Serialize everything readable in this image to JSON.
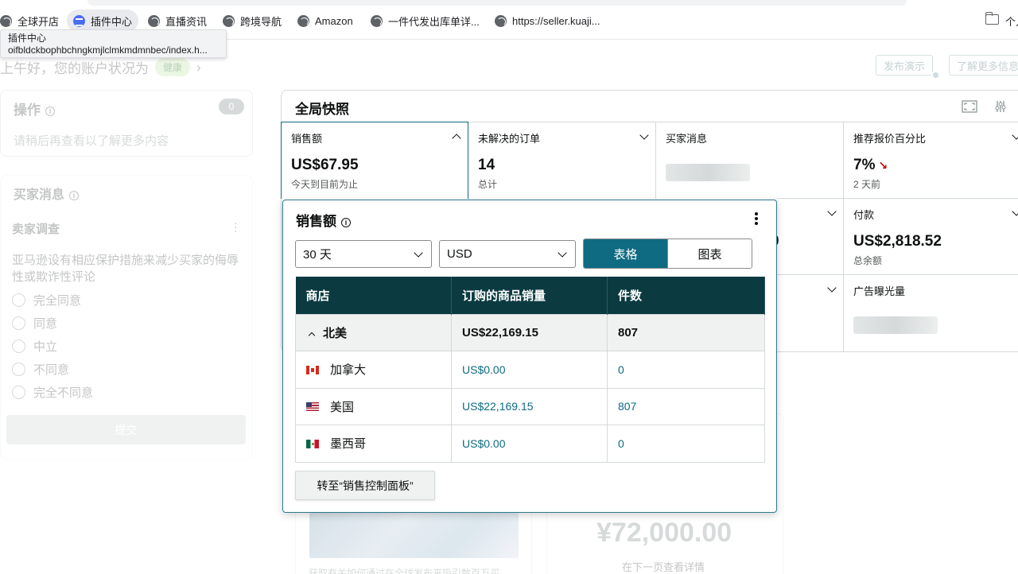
{
  "bookmarks": [
    {
      "label": "全球开店",
      "icon": "globe-icon"
    },
    {
      "label": "插件中心",
      "icon": "extension-icon"
    },
    {
      "label": "直播资讯",
      "icon": "globe-icon"
    },
    {
      "label": "跨境导航",
      "icon": "globe-icon"
    },
    {
      "label": "Amazon",
      "icon": "globe-icon"
    },
    {
      "label": "一件代发出库单详...",
      "icon": "globe-icon"
    },
    {
      "label": "https://seller.kuaji...",
      "icon": "globe-icon"
    }
  ],
  "bookmark_folder_label": "个人",
  "tooltip": {
    "line1": "插件中心",
    "line2": "oifbldckbophbchngkmjlclmkmdmnbec/index.h..."
  },
  "header": {
    "greeting": "上午好，您的账户状况为",
    "health_badge": "健康",
    "chevron": "›",
    "publish_demo": "发布演示",
    "learn_more": "了解更多信息"
  },
  "operations": {
    "title": "操作",
    "count": "0",
    "text": "请稍后再查看以了解更多内容"
  },
  "buyer_messages_card": {
    "title": "买家消息"
  },
  "survey": {
    "title": "卖家调查",
    "question": "亚马逊设有相应保护措施来减少买家的侮辱性或欺诈性评论",
    "options": [
      "完全同意",
      "同意",
      "中立",
      "不同意",
      "完全不同意"
    ],
    "submit": "提交"
  },
  "snapshot": {
    "title": "全局快照",
    "metrics": [
      {
        "label": "销售额",
        "value": "US$67.95",
        "sub": "今天到目前为止"
      },
      {
        "label": "未解决的订单",
        "value": "14",
        "sub": "总计"
      },
      {
        "label": "买家消息"
      },
      {
        "label": "推荐报价百分比",
        "value": "7%",
        "sub": "2 天前"
      },
      {
        "label": "付款",
        "value": "US$2,818.52",
        "sub": "总余额"
      },
      {
        "label": "广告曝光量"
      }
    ],
    "partial_digit": "0"
  },
  "bottom": {
    "amount": "¥72,000.00",
    "next_page": "在下一页查看详情",
    "left_text": "获取有关如何通过在全球发布来吸引数百万买"
  },
  "popover": {
    "title": "销售额",
    "period": "30 天",
    "currency": "USD",
    "view_table": "表格",
    "view_chart": "图表",
    "columns": [
      "商店",
      "订购的商品销量",
      "件数"
    ],
    "group": {
      "name": "北美",
      "sales": "US$22,169.15",
      "units": "807"
    },
    "rows": [
      {
        "store": "加拿大",
        "flag": "canada-flag-icon",
        "sales": "US$0.00",
        "units": "0"
      },
      {
        "store": "美国",
        "flag": "usa-flag-icon",
        "sales": "US$22,169.15",
        "units": "807"
      },
      {
        "store": "墨西哥",
        "flag": "mexico-flag-icon",
        "sales": "US$0.00",
        "units": "0"
      }
    ],
    "go_button": "转至“销售控制面板”"
  },
  "colors": {
    "accent": "#0e6b82",
    "table_header": "#0b3b41",
    "popover_border": "#2b7a8c"
  }
}
